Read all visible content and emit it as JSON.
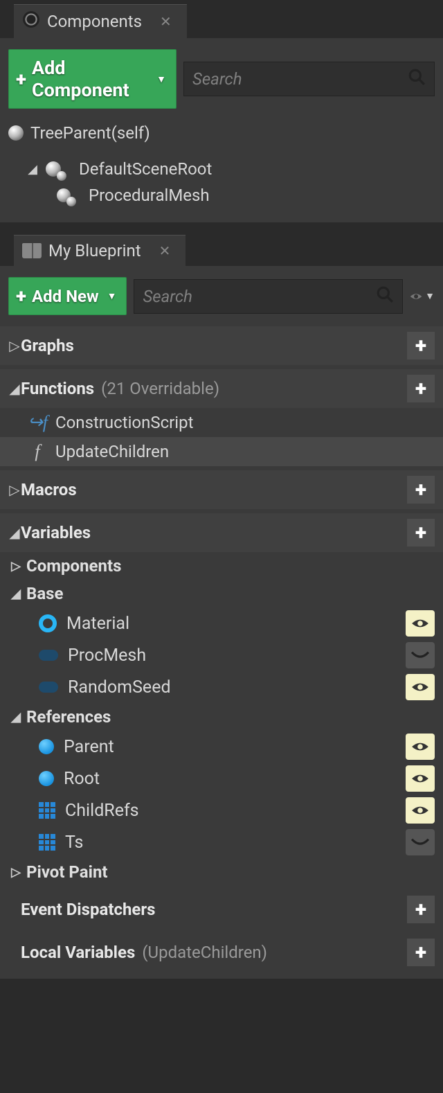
{
  "components_panel": {
    "tab_title": "Components",
    "add_button": "Add Component",
    "search_placeholder": "Search",
    "tree": {
      "root": "TreeParent(self)",
      "scene_root": "DefaultSceneRoot",
      "proc_mesh": "ProceduralMesh"
    }
  },
  "blueprint_panel": {
    "tab_title": "My Blueprint",
    "add_button": "Add New",
    "search_placeholder": "Search",
    "sections": {
      "graphs": {
        "title": "Graphs"
      },
      "functions": {
        "title": "Functions",
        "subtitle": "(21 Overridable)",
        "items": [
          "ConstructionScript",
          "UpdateChildren"
        ]
      },
      "macros": {
        "title": "Macros"
      },
      "variables": {
        "title": "Variables",
        "groups": {
          "components": "Components",
          "base": {
            "title": "Base",
            "vars": [
              {
                "name": "Material",
                "icon": "donut",
                "visible": true
              },
              {
                "name": "ProcMesh",
                "icon": "pill",
                "visible": false
              },
              {
                "name": "RandomSeed",
                "icon": "pill",
                "visible": true
              }
            ]
          },
          "references": {
            "title": "References",
            "vars": [
              {
                "name": "Parent",
                "icon": "ball",
                "visible": true
              },
              {
                "name": "Root",
                "icon": "ball",
                "visible": true
              },
              {
                "name": "ChildRefs",
                "icon": "grid",
                "visible": true
              },
              {
                "name": "Ts",
                "icon": "grid",
                "visible": false
              }
            ]
          },
          "pivot_paint": "Pivot Paint"
        }
      },
      "event_dispatchers": {
        "title": "Event Dispatchers"
      },
      "local_variables": {
        "title": "Local Variables",
        "subtitle": "(UpdateChildren)"
      }
    }
  }
}
